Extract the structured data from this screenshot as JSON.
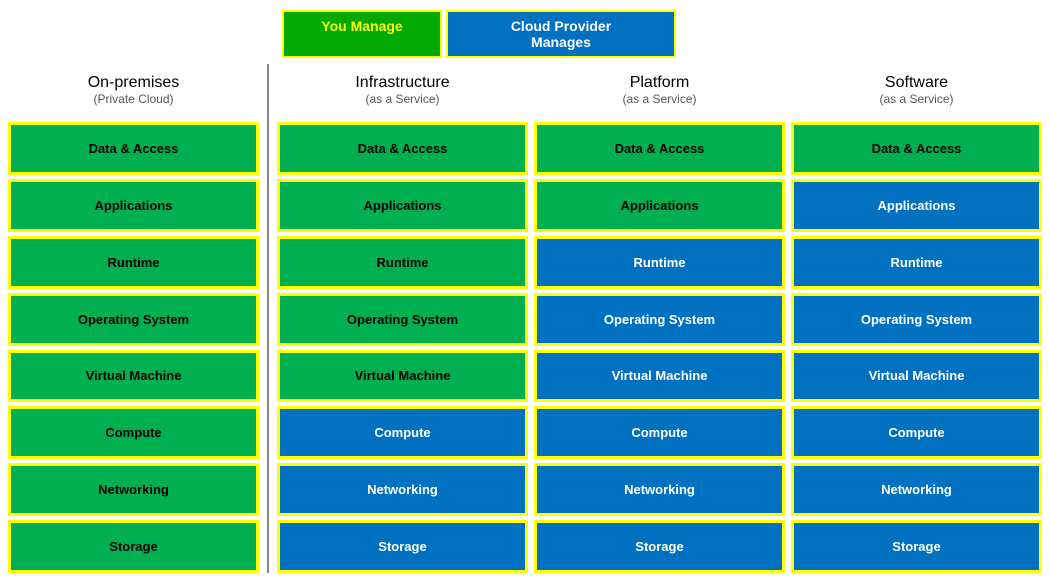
{
  "header": {
    "you_manage": "You Manage",
    "cloud_manages": "Cloud Provider\nManages"
  },
  "columns": [
    {
      "id": "on-premises",
      "title": "On-premises",
      "subtitle": "(Private Cloud)",
      "divider_after": true,
      "rows": [
        {
          "label": "Data & Access",
          "style": "green"
        },
        {
          "label": "Applications",
          "style": "green"
        },
        {
          "label": "Runtime",
          "style": "green"
        },
        {
          "label": "Operating System",
          "style": "green"
        },
        {
          "label": "Virtual Machine",
          "style": "green"
        },
        {
          "label": "Compute",
          "style": "green"
        },
        {
          "label": "Networking",
          "style": "green"
        },
        {
          "label": "Storage",
          "style": "green"
        }
      ]
    },
    {
      "id": "iaas",
      "title": "Infrastructure",
      "subtitle": "(as a Service)",
      "rows": [
        {
          "label": "Data & Access",
          "style": "green"
        },
        {
          "label": "Applications",
          "style": "green"
        },
        {
          "label": "Runtime",
          "style": "green"
        },
        {
          "label": "Operating System",
          "style": "green"
        },
        {
          "label": "Virtual Machine",
          "style": "green"
        },
        {
          "label": "Compute",
          "style": "blue"
        },
        {
          "label": "Networking",
          "style": "blue"
        },
        {
          "label": "Storage",
          "style": "blue"
        }
      ]
    },
    {
      "id": "paas",
      "title": "Platform",
      "subtitle": "(as a Service)",
      "rows": [
        {
          "label": "Data & Access",
          "style": "green"
        },
        {
          "label": "Applications",
          "style": "green"
        },
        {
          "label": "Runtime",
          "style": "blue"
        },
        {
          "label": "Operating System",
          "style": "blue"
        },
        {
          "label": "Virtual Machine",
          "style": "blue"
        },
        {
          "label": "Compute",
          "style": "blue"
        },
        {
          "label": "Networking",
          "style": "blue"
        },
        {
          "label": "Storage",
          "style": "blue"
        }
      ]
    },
    {
      "id": "saas",
      "title": "Software",
      "subtitle": "(as a Service)",
      "rows": [
        {
          "label": "Data & Access",
          "style": "green"
        },
        {
          "label": "Applications",
          "style": "blue"
        },
        {
          "label": "Runtime",
          "style": "blue"
        },
        {
          "label": "Operating System",
          "style": "blue"
        },
        {
          "label": "Virtual Machine",
          "style": "blue"
        },
        {
          "label": "Compute",
          "style": "blue"
        },
        {
          "label": "Networking",
          "style": "blue"
        },
        {
          "label": "Storage",
          "style": "blue"
        }
      ]
    }
  ]
}
